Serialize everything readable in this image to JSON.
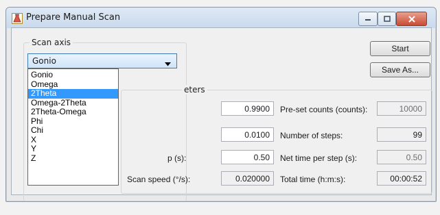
{
  "window": {
    "title": "Prepare Manual Scan"
  },
  "scan_axis": {
    "group_label": "Scan axis",
    "selected_value": "Gonio",
    "options": [
      "Gonio",
      "Omega",
      "2Theta",
      "Omega-2Theta",
      "2Theta-Omega",
      "Phi",
      "Chi",
      "X",
      "Y",
      "Z"
    ],
    "highlighted_option": "2Theta"
  },
  "buttons": {
    "start": "Start",
    "save_as": "Save As..."
  },
  "scan_parameters": {
    "group_label_partial": "eters",
    "range_value": "0.9900",
    "step_value": "0.0100",
    "time_per_step_label_partial": "p (s):",
    "time_per_step_value": "0.50",
    "scan_speed_label": "Scan speed (°/s):",
    "scan_speed_value": "0.020000",
    "preset_counts_label": "Pre-set counts (counts):",
    "preset_counts_value": "10000",
    "number_of_steps_label": "Number of steps:",
    "number_of_steps_value": "99",
    "net_time_label": "Net time per step (s):",
    "net_time_value": "0.50",
    "total_time_label": "Total time (h:m:s):",
    "total_time_value": "00:00:52"
  },
  "colors": {
    "selection": "#3399ff",
    "close_button": "#c94b34"
  }
}
